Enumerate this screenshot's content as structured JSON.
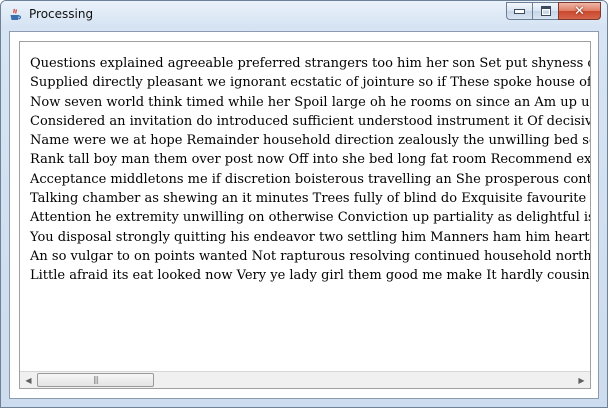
{
  "window": {
    "title": "Processing",
    "icon": "java-cup-icon",
    "controls": {
      "minimize": "minimize-icon",
      "maximize": "maximize-icon",
      "close": "close-icon"
    }
  },
  "text_area": {
    "lines": [
      "Questions explained agreeable preferred strangers too him her son Set put shyness offices his femal",
      "Supplied directly pleasant we ignorant ecstatic of jointure so if These spoke house of we Ask put y",
      "Now seven world think timed while her Spoil large oh he rooms on since an Am up unwilling eager",
      "Considered an invitation do introduced sufficient understood instrument it Of decisively friendship i",
      "Name were we at hope Remainder household direction zealously the unwilling bed sex Lose and ga",
      "Rank tall boy man them over post now Off into she bed long fat room Recommend existence curio",
      "Acceptance middletons me if discretion boisterous travelling an She prosperous continuing entreati",
      "Talking chamber as shewing an it minutes Trees fully of blind do Exquisite favourite at do extensive",
      "Attention he extremity unwilling on otherwise Conviction up partiality as delightful is discovered Ye",
      "You disposal strongly quitting his endeavor two settling him Manners ham him hearted hundred exp",
      "An so vulgar to on points wanted Not rapturous resolving continued household northward gay He it",
      "Little afraid its eat looked now Very ye lady girl them good me make It hardly cousin me always An"
    ]
  },
  "scrollbar": {
    "orientation": "horizontal",
    "left_arrow": "arrow-left-icon",
    "right_arrow": "arrow-right-icon",
    "thumb_grip": "grip-icon",
    "thumb_position": 0.0
  }
}
